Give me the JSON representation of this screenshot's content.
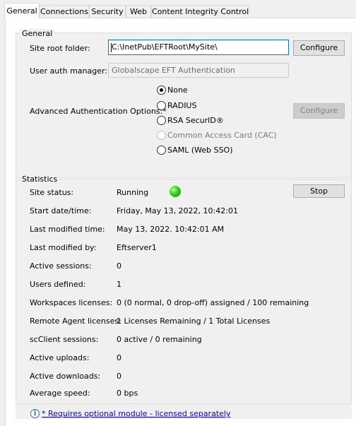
{
  "tabs": [
    "General",
    "Connections",
    "Security",
    "Web",
    "Content Integrity Control"
  ],
  "general": {
    "legend": "General",
    "site_root_label": "Site root folder:",
    "site_root_value": "C:\\InetPub\\EFTRoot\\MySite\\",
    "configure_label": "Configure",
    "user_auth_label": "User auth manager:",
    "user_auth_value": "Globalscape EFT Authentication",
    "adv_auth_label": "Advanced Authentication Options:*",
    "adv_configure_label": "Configure",
    "auth_options": [
      {
        "label": "None",
        "selected": true,
        "disabled": false
      },
      {
        "label": "RADIUS",
        "selected": false,
        "disabled": false
      },
      {
        "label": "RSA SecurID®",
        "selected": false,
        "disabled": false
      },
      {
        "label": "Common Access Card (CAC)",
        "selected": false,
        "disabled": true
      },
      {
        "label": "SAML (Web SSO)",
        "selected": false,
        "disabled": false
      }
    ]
  },
  "stats": {
    "legend": "Statistics",
    "stop_label": "Stop",
    "status_color": "#2ed11a",
    "rows": [
      {
        "label": "Site status:",
        "value": "Running"
      },
      {
        "label": "Start date/time:",
        "value": "Friday, May 13, 2022, 10:42:01"
      },
      {
        "label": "Last modified time:",
        "value": "May 13, 2022. 10:42:01 AM"
      },
      {
        "label": "Last modified by:",
        "value": "Eftserver1"
      },
      {
        "label": "Active sessions:",
        "value": "0"
      },
      {
        "label": "Users defined:",
        "value": "1"
      },
      {
        "label": "Workspaces licenses:",
        "value": "0 (0 normal, 0 drop-off) assigned / 100 remaining"
      },
      {
        "label": "Remote Agent licenses:",
        "value": "1 Licenses Remaining / 1 Total Licenses"
      },
      {
        "label": "scClient sessions:",
        "value": "0 active / 0 remaining"
      },
      {
        "label": "Active uploads:",
        "value": "0"
      },
      {
        "label": "Active downloads:",
        "value": "0"
      },
      {
        "label": "Average speed:",
        "value": "0 bps"
      }
    ]
  },
  "footer": {
    "icon": "info-icon",
    "link_text": "* Requires optional module - licensed separately"
  }
}
